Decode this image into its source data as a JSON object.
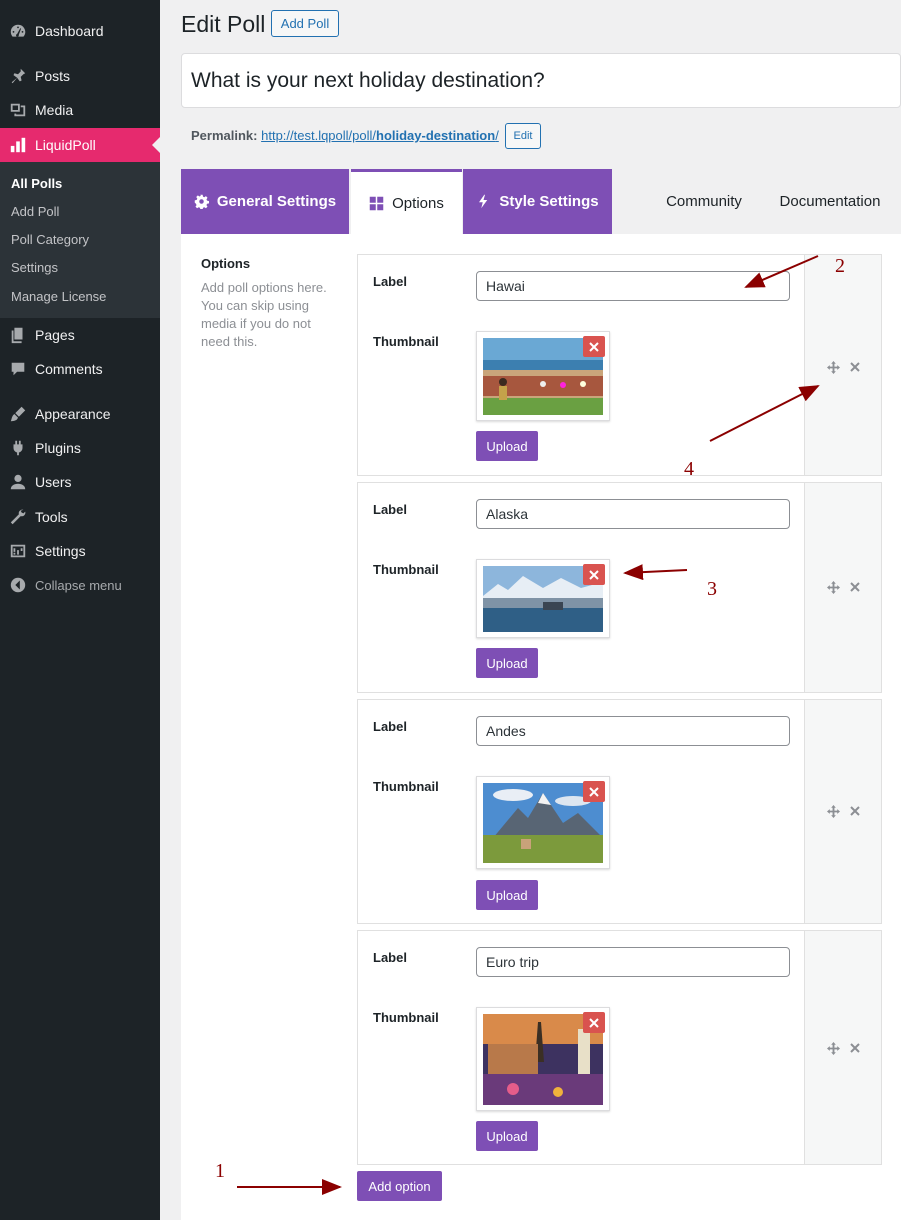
{
  "sidebar": {
    "items": [
      {
        "label": "Dashboard",
        "icon": "dashboard-icon"
      },
      {
        "label": "Posts",
        "icon": "pin-icon"
      },
      {
        "label": "Media",
        "icon": "media-icon"
      },
      {
        "label": "LiquidPoll",
        "icon": "bar-chart-icon"
      },
      {
        "label": "Pages",
        "icon": "pages-icon"
      },
      {
        "label": "Comments",
        "icon": "comment-icon"
      },
      {
        "label": "Appearance",
        "icon": "brush-icon"
      },
      {
        "label": "Plugins",
        "icon": "plug-icon"
      },
      {
        "label": "Users",
        "icon": "user-icon"
      },
      {
        "label": "Tools",
        "icon": "wrench-icon"
      },
      {
        "label": "Settings",
        "icon": "settings-icon"
      },
      {
        "label": "Collapse menu",
        "icon": "collapse-icon"
      }
    ],
    "submenu": [
      "All Polls",
      "Add Poll",
      "Poll Category",
      "Settings",
      "Manage License"
    ]
  },
  "header": {
    "title": "Edit Poll",
    "add_button": "Add Poll",
    "poll_title": "What is your next holiday destination?",
    "permalink_label": "Permalink:",
    "permalink_base": "http://test.lqpoll/poll/",
    "permalink_slug": "holiday-destination",
    "permalink_trail": "/",
    "edit_button": "Edit"
  },
  "tabs": [
    {
      "label": "General Settings",
      "icon": "gear-icon"
    },
    {
      "label": "Options",
      "icon": "grid-icon"
    },
    {
      "label": "Style Settings",
      "icon": "bolt-icon"
    },
    {
      "label": "Community"
    },
    {
      "label": "Documentation"
    }
  ],
  "options_section": {
    "heading": "Options",
    "description": "Add poll options here. You can skip using media if you do not need this."
  },
  "poll_options": [
    {
      "label_caption": "Label",
      "value": "Hawai",
      "thumb_caption": "Thumbnail",
      "upload": "Upload"
    },
    {
      "label_caption": "Label",
      "value": "Alaska",
      "thumb_caption": "Thumbnail",
      "upload": "Upload"
    },
    {
      "label_caption": "Label",
      "value": "Andes",
      "thumb_caption": "Thumbnail",
      "upload": "Upload"
    },
    {
      "label_caption": "Label",
      "value": "Euro trip",
      "thumb_caption": "Thumbnail",
      "upload": "Upload"
    }
  ],
  "add_option": "Add option",
  "annotations": [
    "1",
    "2",
    "3",
    "4"
  ],
  "colors": {
    "sidebar_bg": "#1d2327",
    "active_menu": "#e62a6e",
    "accent_purple": "#7e4fb5",
    "link_blue": "#2271b1",
    "annotation": "#8b0000",
    "delete_red": "#d9534f"
  }
}
